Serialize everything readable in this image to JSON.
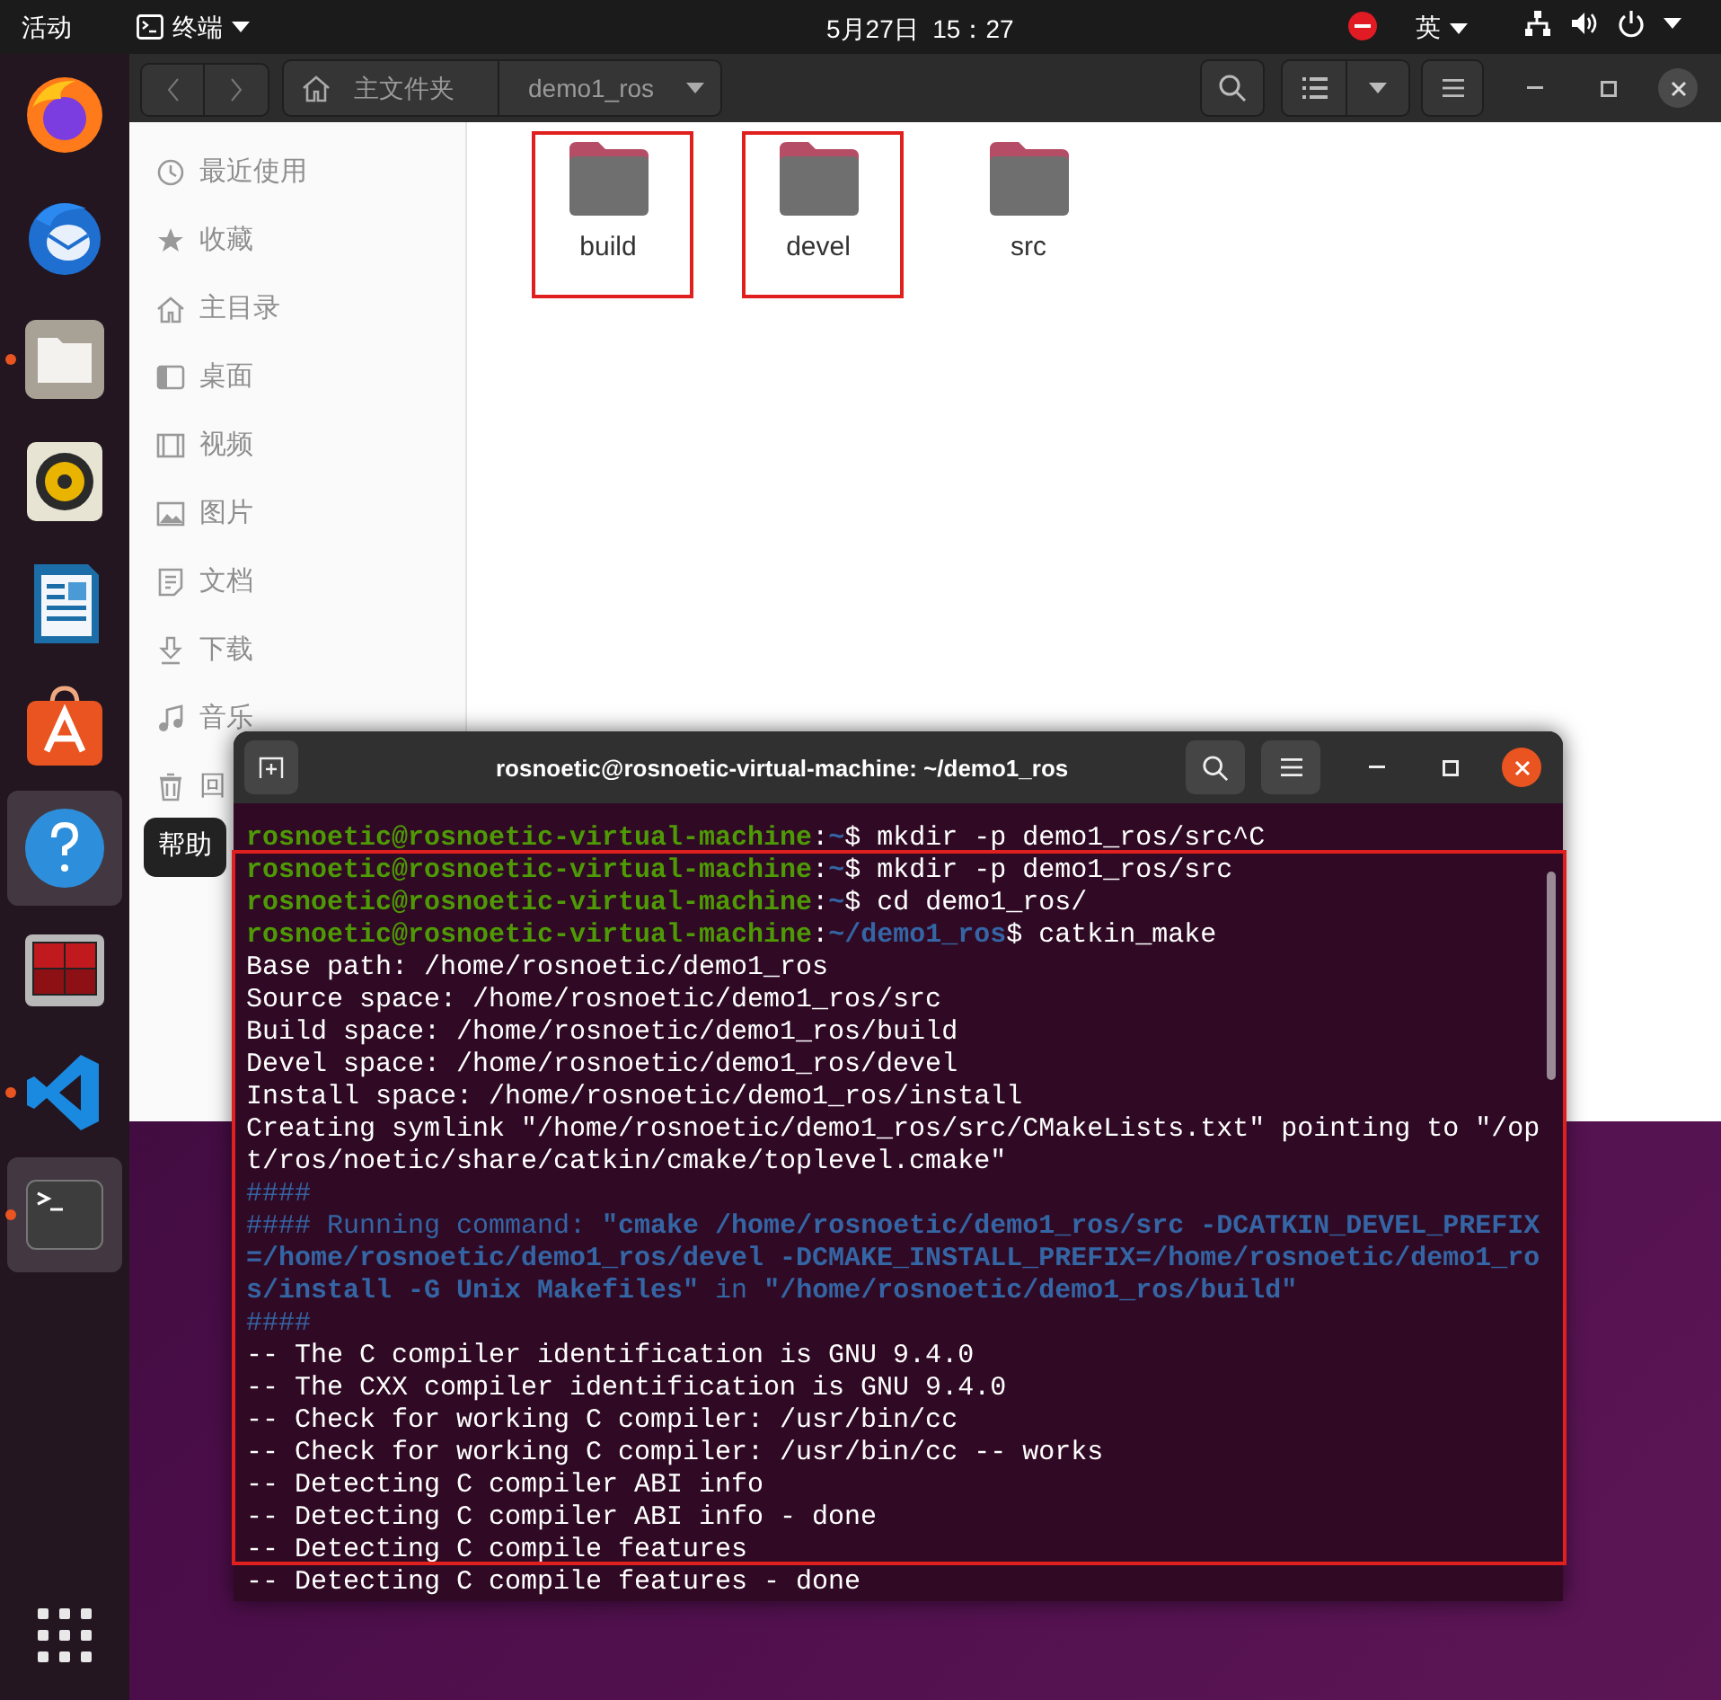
{
  "top_bar": {
    "activities": "活动",
    "app_menu": "终端",
    "clock": "5月27日  15：27",
    "input_method": "英"
  },
  "dock": {
    "items": [
      {
        "kind": "browser",
        "running": false,
        "selected": false
      },
      {
        "kind": "mail",
        "running": false,
        "selected": false
      },
      {
        "kind": "files",
        "running": true,
        "selected": false
      },
      {
        "kind": "music",
        "running": false,
        "selected": false
      },
      {
        "kind": "writer",
        "running": false,
        "selected": false
      },
      {
        "kind": "store",
        "running": false,
        "selected": false
      },
      {
        "kind": "help",
        "running": false,
        "selected": true
      },
      {
        "kind": "workspaces",
        "running": false,
        "selected": false
      },
      {
        "kind": "code",
        "running": true,
        "selected": false
      },
      {
        "kind": "terminal",
        "running": true,
        "selected": true
      }
    ],
    "tooltip": "帮助"
  },
  "file_manager": {
    "path": [
      "主文件夹",
      "demo1_ros"
    ],
    "sidebar": [
      {
        "kind": "recent",
        "label": "最近使用"
      },
      {
        "kind": "star",
        "label": "收藏"
      },
      {
        "kind": "home",
        "label": "主目录"
      },
      {
        "kind": "desktop",
        "label": "桌面"
      },
      {
        "kind": "video",
        "label": "视频"
      },
      {
        "kind": "picture",
        "label": "图片"
      },
      {
        "kind": "document",
        "label": "文档"
      },
      {
        "kind": "download",
        "label": "下载"
      },
      {
        "kind": "music",
        "label": "音乐"
      },
      {
        "kind": "trash",
        "label": "回"
      }
    ],
    "files": [
      {
        "name": "build",
        "highlighted": true
      },
      {
        "name": "devel",
        "highlighted": true
      },
      {
        "name": "src",
        "highlighted": false
      }
    ]
  },
  "terminal": {
    "title": "rosnoetic@rosnoetic-virtual-machine: ~/demo1_ros",
    "output_highlighted": true,
    "lines": [
      [
        {
          "kind": "user",
          "text": "rosnoetic@rosnoetic-virtual-machine"
        },
        {
          "kind": "plain",
          "text": ":"
        },
        {
          "kind": "path",
          "text": "~"
        },
        {
          "kind": "plain",
          "text": "$ mkdir -p demo1_ros/src^C"
        }
      ],
      [
        {
          "kind": "user",
          "text": "rosnoetic@rosnoetic-virtual-machine"
        },
        {
          "kind": "plain",
          "text": ":"
        },
        {
          "kind": "path",
          "text": "~"
        },
        {
          "kind": "plain",
          "text": "$ mkdir -p demo1_ros/src"
        }
      ],
      [
        {
          "kind": "user",
          "text": "rosnoetic@rosnoetic-virtual-machine"
        },
        {
          "kind": "plain",
          "text": ":"
        },
        {
          "kind": "path",
          "text": "~"
        },
        {
          "kind": "plain",
          "text": "$ cd demo1_ros/"
        }
      ],
      [
        {
          "kind": "user",
          "text": "rosnoetic@rosnoetic-virtual-machine"
        },
        {
          "kind": "plain",
          "text": ":"
        },
        {
          "kind": "path",
          "text": "~/demo1_ros"
        },
        {
          "kind": "plain",
          "text": "$ catkin_make"
        }
      ],
      [
        {
          "kind": "plain",
          "text": "Base path: /home/rosnoetic/demo1_ros"
        }
      ],
      [
        {
          "kind": "plain",
          "text": "Source space: /home/rosnoetic/demo1_ros/src"
        }
      ],
      [
        {
          "kind": "plain",
          "text": "Build space: /home/rosnoetic/demo1_ros/build"
        }
      ],
      [
        {
          "kind": "plain",
          "text": "Devel space: /home/rosnoetic/demo1_ros/devel"
        }
      ],
      [
        {
          "kind": "plain",
          "text": "Install space: /home/rosnoetic/demo1_ros/install"
        }
      ],
      [
        {
          "kind": "plain",
          "text": "Creating symlink \"/home/rosnoetic/demo1_ros/src/CMakeLists.txt\" pointing to \"/op"
        }
      ],
      [
        {
          "kind": "plain",
          "text": "t/ros/noetic/share/catkin/cmake/toplevel.cmake\""
        }
      ],
      [
        {
          "kind": "info",
          "text": "####"
        }
      ],
      [
        {
          "kind": "info",
          "text": "#### Running command: "
        },
        {
          "kind": "info_bold",
          "text": "\"cmake /home/rosnoetic/demo1_ros/src -DCATKIN_DEVEL_PREFIX"
        }
      ],
      [
        {
          "kind": "info_bold",
          "text": "=/home/rosnoetic/demo1_ros/devel -DCMAKE_INSTALL_PREFIX=/home/rosnoetic/demo1_ro"
        }
      ],
      [
        {
          "kind": "info_bold",
          "text": "s/install -G Unix Makefiles\""
        },
        {
          "kind": "info",
          "text": " in "
        },
        {
          "kind": "info_bold",
          "text": "\"/home/rosnoetic/demo1_ros/build\""
        }
      ],
      [
        {
          "kind": "info",
          "text": "####"
        }
      ],
      [
        {
          "kind": "plain",
          "text": "-- The C compiler identification is GNU 9.4.0"
        }
      ],
      [
        {
          "kind": "plain",
          "text": "-- The CXX compiler identification is GNU 9.4.0"
        }
      ],
      [
        {
          "kind": "plain",
          "text": "-- Check for working C compiler: /usr/bin/cc"
        }
      ],
      [
        {
          "kind": "plain",
          "text": "-- Check for working C compiler: /usr/bin/cc -- works"
        }
      ],
      [
        {
          "kind": "plain",
          "text": "-- Detecting C compiler ABI info"
        }
      ],
      [
        {
          "kind": "plain",
          "text": "-- Detecting C compiler ABI info - done"
        }
      ],
      [
        {
          "kind": "plain",
          "text": "-- Detecting C compile features"
        }
      ],
      [
        {
          "kind": "plain",
          "text": "-- Detecting C compile features - done"
        }
      ]
    ]
  }
}
